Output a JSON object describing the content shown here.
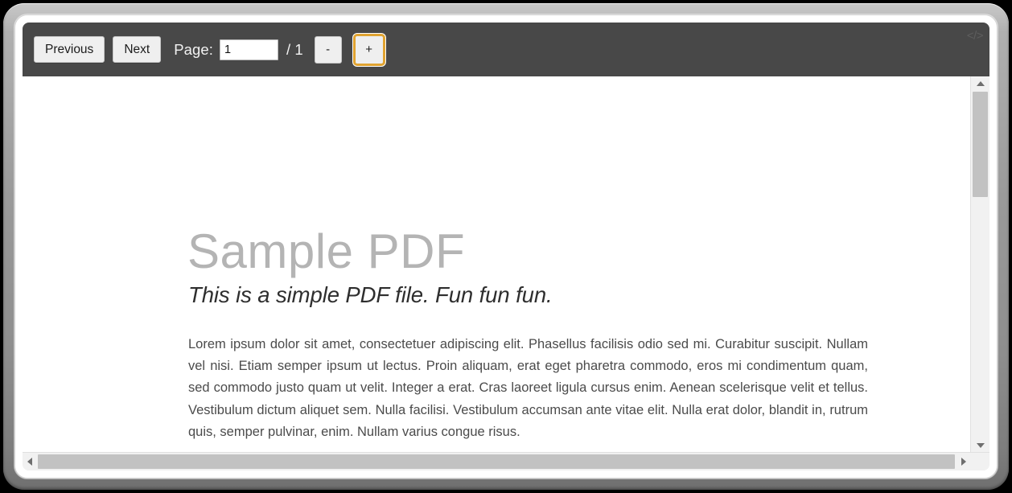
{
  "toolbar": {
    "previous_label": "Previous",
    "next_label": "Next",
    "page_label": "Page:",
    "page_value": "1",
    "page_total": "/ 1",
    "zoom_out_label": "-",
    "zoom_in_label": "+",
    "code_icon": "</>",
    "background_color": "#484848",
    "focus_ring_color": "#e0a331"
  },
  "document": {
    "title": "Sample PDF",
    "subtitle": "This is a simple PDF file. Fun fun fun.",
    "body": "Lorem ipsum dolor sit amet, consectetuer adipiscing elit. Phasellus facilisis odio sed mi. Curabitur suscipit. Nullam vel nisi. Etiam semper ipsum ut lectus. Proin aliquam, erat eget pharetra commodo, eros mi condimentum quam, sed commodo justo quam ut velit. Integer a erat. Cras laoreet ligula cursus enim. Aenean scelerisque velit et tellus. Vestibulum dictum aliquet sem. Nulla facilisi. Vestibulum accumsan ante vitae elit. Nulla erat dolor, blandit in, rutrum quis, semper pulvinar, enim. Nullam varius congue risus.",
    "title_color": "#b4b4b4",
    "body_color": "#4b4b4b"
  },
  "scrollbars": {
    "vertical_up_icon": "triangle-up",
    "vertical_down_icon": "triangle-down",
    "horizontal_left_icon": "triangle-left",
    "horizontal_right_icon": "triangle-right",
    "thumb_color": "#c2c2c2"
  }
}
